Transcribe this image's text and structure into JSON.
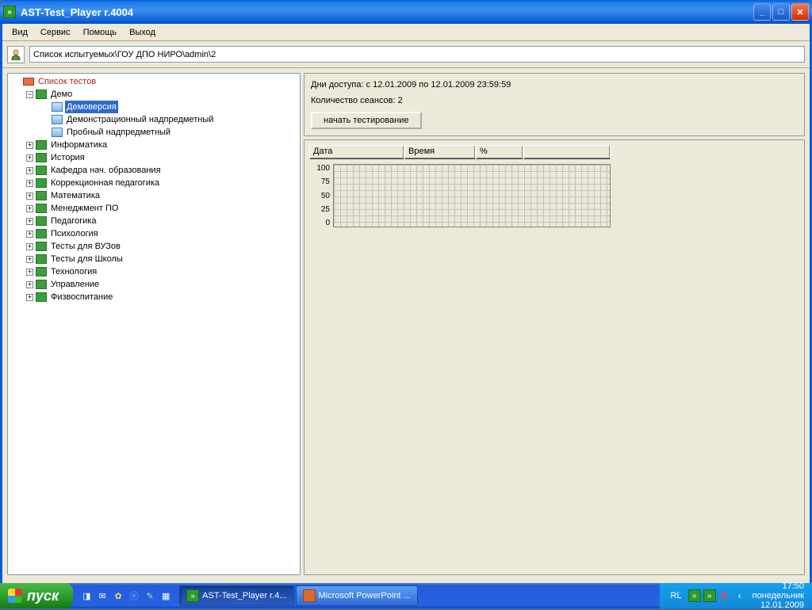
{
  "window": {
    "title": "AST-Test_Player  r.4004"
  },
  "menu": {
    "items": [
      "Вид",
      "Сервис",
      "Помощь",
      "Выход"
    ]
  },
  "path": "Список испытуемых\\ГОУ ДПО НИРО\\admin\\2",
  "tree": {
    "root": "Список тестов",
    "demo": {
      "label": "Демо",
      "children": [
        "Демоверсия",
        "Демонстрационный надпредметный",
        "Пробный надпредметный"
      ]
    },
    "folders": [
      "Информатика",
      "История",
      "Кафедра нач. образования",
      "Коррекционная педагогика",
      "Математика",
      "Менеджмент ПО",
      "Педагогика",
      "Психология",
      "Тесты для ВУЗов",
      "Тесты для Школы",
      "Технология",
      "Управление",
      "Физвоспитание"
    ]
  },
  "info": {
    "access": "Дни доступа:  с 12.01.2009 по 12.01.2009 23:59:59",
    "sessions": "Количество сеансов: 2",
    "start_btn": "начать тестирование"
  },
  "table": {
    "cols": [
      "Дата",
      "Время",
      "%"
    ]
  },
  "chart_data": {
    "type": "bar",
    "categories": [],
    "values": [],
    "title": "",
    "xlabel": "",
    "ylabel": "",
    "ylim": [
      0,
      100
    ],
    "yticks": [
      100,
      75,
      50,
      25,
      0
    ]
  },
  "taskbar": {
    "start": "пуск",
    "tasks": [
      {
        "label": "AST-Test_Player  r.4..."
      },
      {
        "label": "Microsoft PowerPoint ..."
      }
    ],
    "lang": "RL",
    "time": "17:50",
    "day": "понедельник",
    "date": "12.01.2009"
  }
}
